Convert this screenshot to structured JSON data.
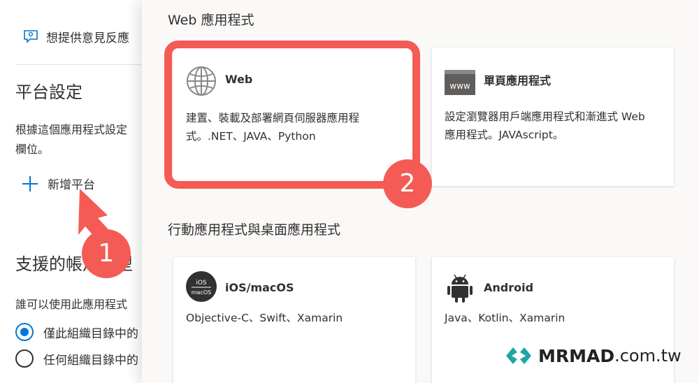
{
  "left": {
    "feedback_label": "想提供意見反應",
    "platform_heading": "平台設定",
    "description_lines": [
      "根據這個應用程式設定",
      "欄位。"
    ],
    "add_platform_label": "新增平台",
    "support_heading": "支援的帳戶類型",
    "who_label": "誰可以使用此應用程式",
    "radio_1_label": "僅此組織目錄中的",
    "radio_2_label": "任何組織目錄中的",
    "radio_1_selected": true
  },
  "panel": {
    "web_section_title": "Web 應用程式",
    "mobile_section_title": "行動應用程式與桌面應用程式",
    "cards": [
      {
        "title": "Web",
        "desc": "建置、裝載及部署網頁伺服器應用程式。.NET、JAVA、Python",
        "icon": "globe-icon"
      },
      {
        "title": "單頁應用程式",
        "desc": "設定瀏覽器用戶端應用程式和漸進式 Web 應用程式。JAVAscript。",
        "icon": "browser-window-icon",
        "icon_text": "www"
      },
      {
        "title": "iOS/macOS",
        "desc": "Objective-C、Swift、Xamarin",
        "icon": "ios-macos-icon",
        "icon_text_1": "iOS",
        "icon_text_2": "macOS"
      },
      {
        "title": "Android",
        "desc": "Java、Kotlin、Xamarin",
        "icon": "android-icon"
      }
    ]
  },
  "annotations": {
    "step_1": "1",
    "step_2": "2",
    "highlight_color": "#f45b55"
  },
  "watermark": {
    "brand": "MRMAD",
    "domain": ".com.tw"
  },
  "colors": {
    "accent": "#0078d4",
    "text": "#323130",
    "panel_bg": "#faf9f8"
  }
}
